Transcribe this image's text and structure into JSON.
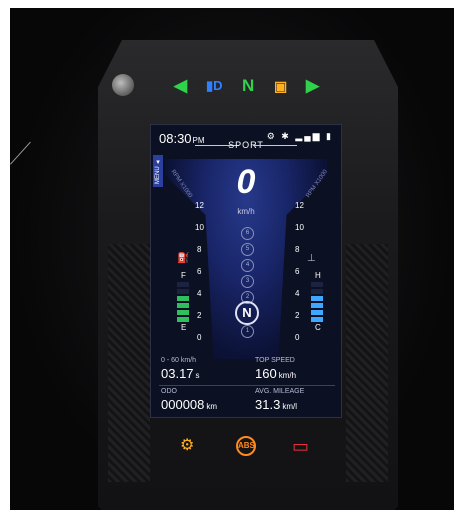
{
  "status": {
    "time": "08:30",
    "time_suffix": "PM",
    "mode": "SPORT",
    "icons": "⚙ ✱ ▂▄▆ ▮"
  },
  "indicators_top": {
    "left_turn": "◀",
    "headlight": "▮D",
    "neutral": "N",
    "fuel_warning": "▣",
    "right_turn": "▶"
  },
  "menu": {
    "label": "MENU ▲"
  },
  "speed": {
    "value": "0",
    "unit": "km/h"
  },
  "rpm": {
    "label": "RPM X1000",
    "ticks": [
      "12",
      "10",
      "8",
      "6",
      "4",
      "2",
      "0"
    ]
  },
  "gears": {
    "list": [
      "6",
      "5",
      "4",
      "3",
      "2",
      "1"
    ],
    "current": "N"
  },
  "fuel": {
    "full_label": "F",
    "empty_label": "E",
    "icon": "⛽",
    "level": 0.6
  },
  "temp": {
    "hot_label": "H",
    "cold_label": "C",
    "icon": "⊥",
    "level": 0.6
  },
  "metrics": {
    "accel_label": "0 - 60 km/h",
    "accel_value": "03.17",
    "accel_unit": "s",
    "top_speed_label": "TOP SPEED",
    "top_speed_value": "160",
    "top_speed_unit": "km/h",
    "odo_label": "ODO",
    "odo_value": "000008",
    "odo_unit": "km",
    "mileage_label": "AVG. MILEAGE",
    "mileage_value": "31.3",
    "mileage_unit": "km/l"
  },
  "indicators_bottom": {
    "engine": "⚙",
    "abs": "ABS",
    "battery": "▭"
  },
  "colors": {
    "green": "#2fd24a",
    "blue": "#2f7fff",
    "amber": "#ffb020",
    "red": "#e8313f",
    "bar_green": "#2fbf5e",
    "bar_blue": "#3ea7ff"
  }
}
